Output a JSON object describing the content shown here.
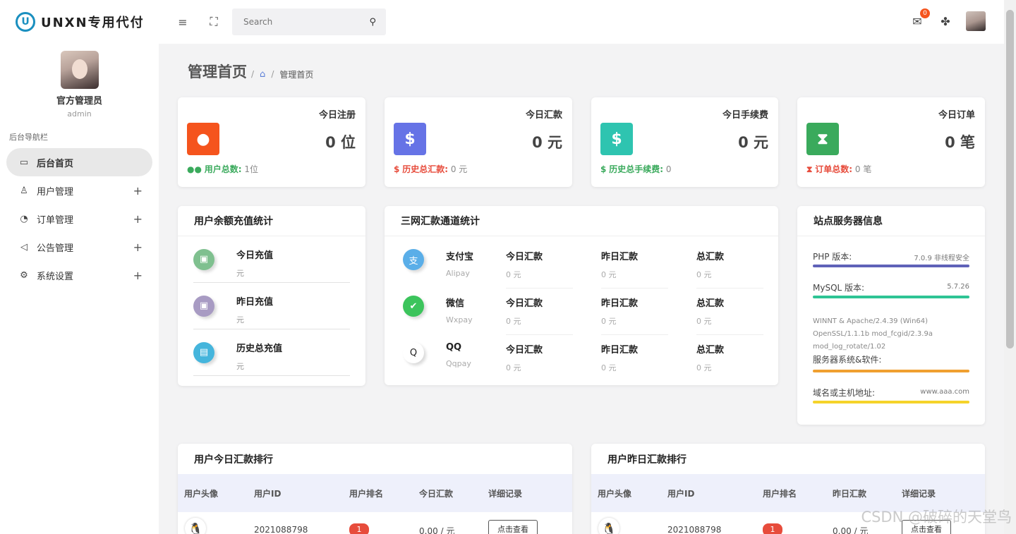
{
  "brand": {
    "logo_letter": "U",
    "name": "UNXN专用代付"
  },
  "profile": {
    "name": "官方管理员",
    "role": "admin"
  },
  "nav_title": "后台导航栏",
  "nav": [
    {
      "label": "后台首页",
      "icon": "monitor-icon",
      "glyph": "▭"
    },
    {
      "label": "用户管理",
      "icon": "user-icon",
      "glyph": "♙"
    },
    {
      "label": "订单管理",
      "icon": "clock-icon",
      "glyph": "◔"
    },
    {
      "label": "公告管理",
      "icon": "speaker-icon",
      "glyph": "◁"
    },
    {
      "label": "系统设置",
      "icon": "gear-icon",
      "glyph": "⚙"
    }
  ],
  "header": {
    "search_placeholder": "Search",
    "mail_badge": "0"
  },
  "breadcrumb": {
    "title": "管理首页",
    "current": "管理首页"
  },
  "stats": [
    {
      "label": "今日注册",
      "value": "0 位",
      "foot_key": "用户总数:",
      "foot_val": "1位",
      "color": "#f5541d",
      "key_color": "#3aaa5c",
      "glyph": "●"
    },
    {
      "label": "今日汇款",
      "value": "0 元",
      "foot_key": "历史总汇款:",
      "foot_val": "0 元",
      "color": "#6673e6",
      "key_color": "#e74c3c",
      "glyph": "$"
    },
    {
      "label": "今日手续费",
      "value": "0 元",
      "foot_key": "历史总手续费:",
      "foot_val": "0",
      "color": "#2ec4b0",
      "key_color": "#3aaa5c",
      "glyph": "$"
    },
    {
      "label": "今日订单",
      "value": "0 笔",
      "foot_key": "订单总数:",
      "foot_val": "0 笔",
      "color": "#3aaa5c",
      "key_color": "#e74c3c",
      "glyph": "⧗"
    }
  ],
  "recharge": {
    "title": "用户余额充值统计",
    "items": [
      {
        "label": "今日充值",
        "unit": "元",
        "color": "#7fc08f"
      },
      {
        "label": "昨日充值",
        "unit": "元",
        "color": "#a89bc3"
      },
      {
        "label": "历史总充值",
        "unit": "元",
        "color": "#45b5dc"
      }
    ]
  },
  "channels": {
    "title": "三网汇款通道统计",
    "cols": [
      "今日汇款",
      "昨日汇款",
      "总汇款"
    ],
    "items": [
      {
        "name": "支付宝",
        "sub": "Alipay",
        "vals": [
          "0 元",
          "0 元",
          "0 元"
        ],
        "color": "#5aaee8",
        "glyph": "支"
      },
      {
        "name": "微信",
        "sub": "Wxpay",
        "vals": [
          "0 元",
          "0 元",
          "0 元"
        ],
        "color": "#3cc45c",
        "glyph": "✔"
      },
      {
        "name": "QQ",
        "sub": "Qqpay",
        "vals": [
          "0 元",
          "0 元",
          "0 元"
        ],
        "color": "#222222",
        "glyph": "Q"
      }
    ]
  },
  "server": {
    "title": "站点服务器信息",
    "php_label": "PHP 版本:",
    "php_value": "7.0.9 非线程安全",
    "mysql_label": "MySQL 版本:",
    "mysql_value": "5.7.26",
    "software_line1": "WINNT & Apache/2.4.39 (Win64)",
    "software_line2": "OpenSSL/1.1.1b mod_fcgid/2.3.9a",
    "software_line3": "mod_log_rotate/1.02",
    "software_label": "服务器系统&软件:",
    "domain_label": "域名或主机地址:",
    "domain_value": "www.aaa.com"
  },
  "rank_today": {
    "title": "用户今日汇款排行",
    "cols": [
      "用户头像",
      "用户ID",
      "用户排名",
      "今日汇款",
      "详细记录"
    ],
    "row": {
      "id": "2021088798",
      "rank": "1",
      "amount": "0.00 / 元",
      "button": "点击查看"
    }
  },
  "rank_yesterday": {
    "title": "用户昨日汇款排行",
    "cols": [
      "用户头像",
      "用户ID",
      "用户排名",
      "昨日汇款",
      "详细记录"
    ],
    "row": {
      "id": "2021088798",
      "rank": "1",
      "amount": "0.00 / 元",
      "button": "点击查看"
    }
  },
  "watermark": "CSDN @破碎的天堂鸟"
}
